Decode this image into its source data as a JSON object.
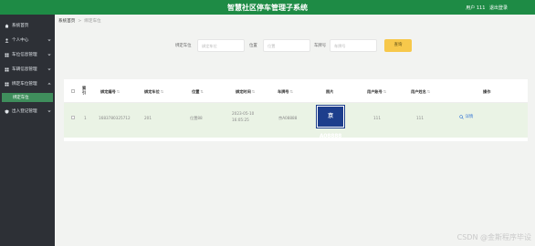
{
  "header": {
    "title": "智慧社区停车管理子系统",
    "user_label": "用户 111",
    "logout_label": "退出登录"
  },
  "sidebar": {
    "items": [
      {
        "label": "系统首页",
        "icon": "home-icon"
      },
      {
        "label": "个人中心",
        "icon": "user-icon",
        "expand": true
      },
      {
        "label": "车位信息管理",
        "icon": "grid-icon",
        "expand": true
      },
      {
        "label": "车辆信息管理",
        "icon": "grid-icon",
        "expand": true
      },
      {
        "label": "绑定车位管理",
        "icon": "grid-icon",
        "expand": true
      },
      {
        "label": "出入登记管理",
        "icon": "shield-icon",
        "expand": true
      }
    ],
    "active_sub": "绑定车位"
  },
  "breadcrumb": {
    "home": "系统首页",
    "current": "绑定车位"
  },
  "search": {
    "fields": [
      {
        "label": "绑定车位",
        "placeholder": "绑定车位"
      },
      {
        "label": "位置",
        "placeholder": "位置"
      },
      {
        "label": "车牌号",
        "placeholder": "车牌号"
      }
    ],
    "button": "查询"
  },
  "table": {
    "columns": [
      "索引",
      "绑定编号",
      "绑定车位",
      "位置",
      "绑定时间",
      "车牌号",
      "照片",
      "用户账号",
      "用户姓名",
      "操作"
    ],
    "rows": [
      {
        "index": "1",
        "bind_no": "1683780325712",
        "space": "201",
        "location": "位置88",
        "time": "2023-05-10 16:05:25",
        "plate": "京A08888",
        "photo_text": "京A08888",
        "account": "111",
        "name": "111",
        "action": "详情"
      }
    ]
  },
  "watermark": "CSDN @金斯程序毕设",
  "colors": {
    "header": "#1e8b45",
    "sidebar": "#2d3036",
    "active": "#3f8e5c",
    "search_button": "#f7c84b",
    "plate": "#1d3e8c"
  }
}
